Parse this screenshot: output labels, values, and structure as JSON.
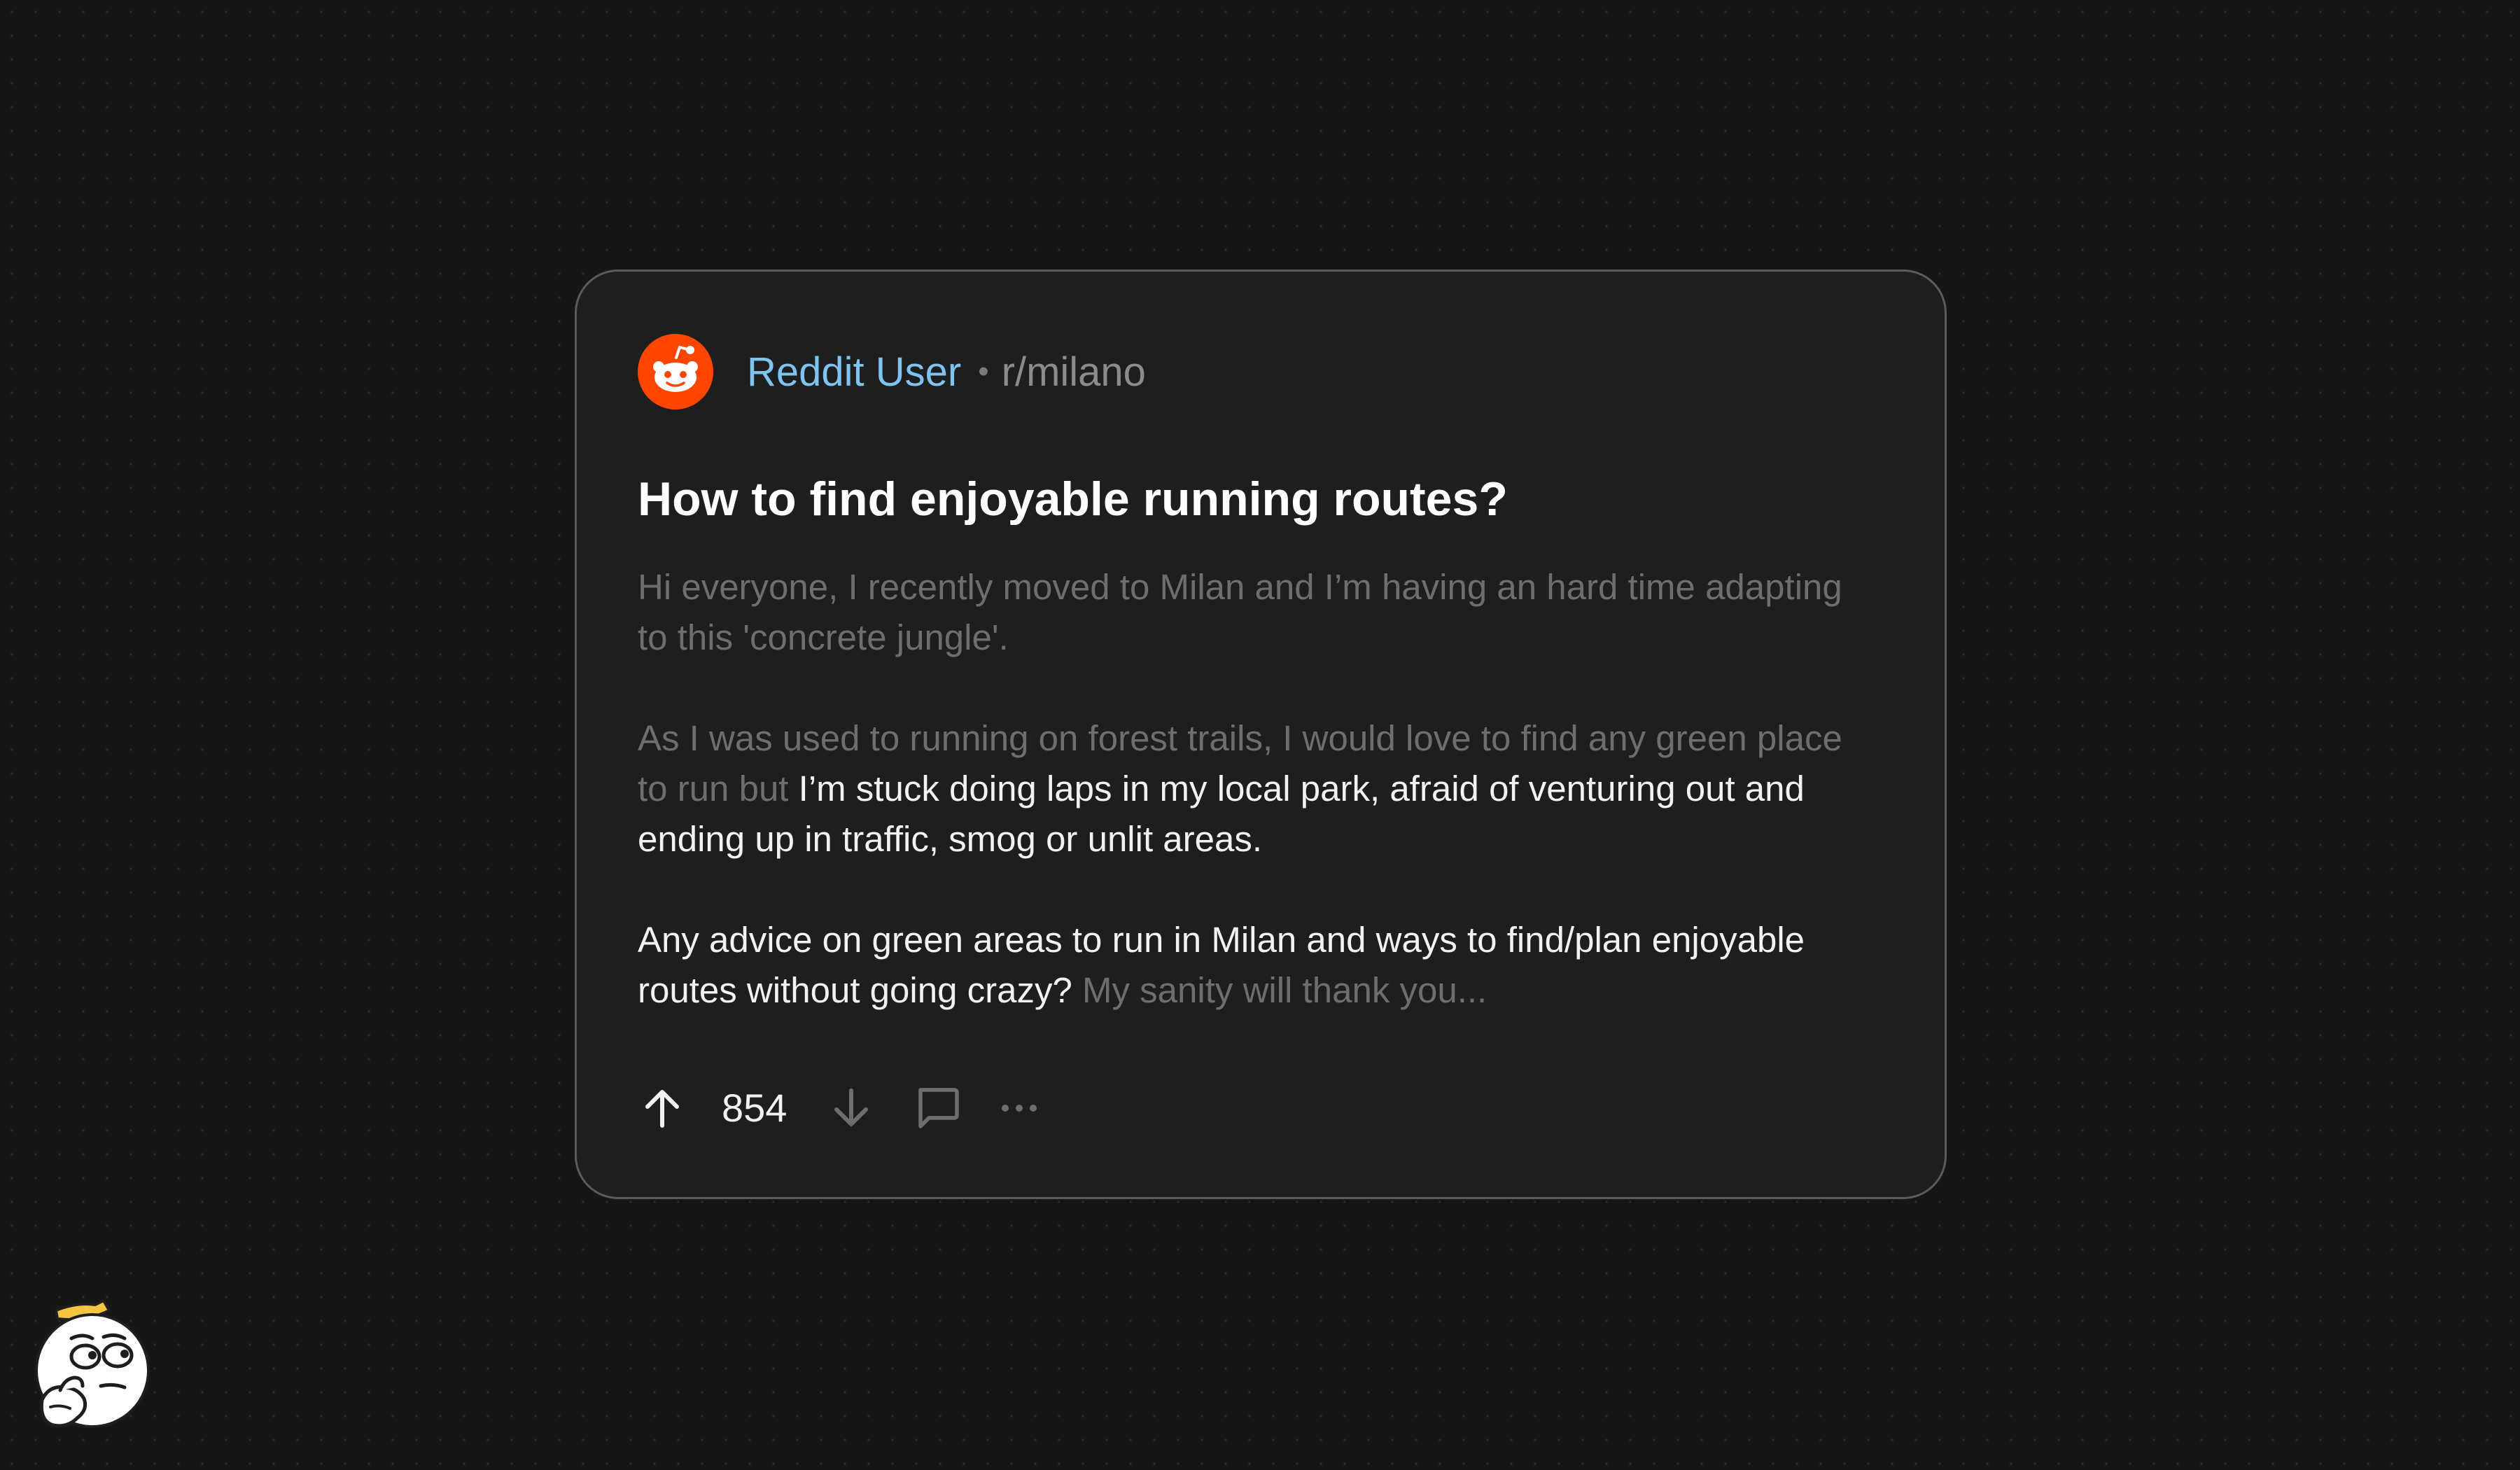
{
  "post": {
    "username": "Reddit User",
    "separator": "•",
    "subreddit": "r/milano",
    "title": "How to find enjoyable running routes?",
    "body": {
      "p1_line1": "Hi everyone, I recently moved to Milan and I’m having an hard time adapting",
      "p1_line2": "to this 'concrete jungle'.",
      "p2_line1_dim": "As I was used to running on forest trails, I would love to find any green place",
      "p2_line2_dim": "to run but ",
      "p2_line2_bright": "I’m stuck doing laps in my local park, afraid of venturing out and",
      "p2_line3": "ending up in traffic, smog or unlit areas.",
      "p3_line1": "Any advice on green areas to run in Milan and ways to find/plan enjoyable",
      "p3_line2_bright": "routes without going crazy? ",
      "p3_line2_dim": "My sanity will thank you..."
    },
    "vote_count": "854"
  },
  "icons": {
    "avatar": "reddit-snoo-icon",
    "upvote": "arrow-up-icon",
    "downvote": "arrow-down-icon",
    "comment": "comment-bubble-icon",
    "more": "more-dots-icon",
    "mascot": "thinking-face-icon"
  },
  "colors": {
    "background": "#161616",
    "card": "#1e1e1e",
    "card_border": "#5b5b5b",
    "username": "#7fc4f0",
    "reddit_orange": "#ff4500",
    "text_bright": "#f2f2f2",
    "text_dim": "#6e6e6e"
  }
}
